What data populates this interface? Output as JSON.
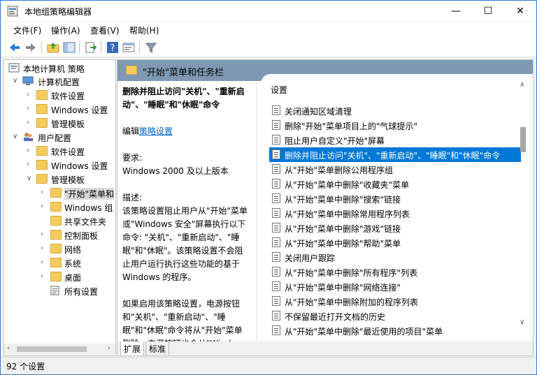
{
  "window": {
    "title": "本地组策略编辑器",
    "minimize": "—",
    "maximize": "☐",
    "close": "✕"
  },
  "menu": {
    "items": [
      "文件(F)",
      "操作(A)",
      "查看(V)",
      "帮助(H)"
    ]
  },
  "toolbar": {
    "icons": [
      "back-arrow-icon",
      "forward-arrow-icon",
      "up-folder-icon",
      "show-hide-tree-icon",
      "export-list-icon",
      "help-icon",
      "properties-icon",
      "filter-icon"
    ]
  },
  "tree": {
    "root": "本地计算机 策略",
    "computer_config": "计算机配置",
    "cc_software": "软件设置",
    "cc_windows": "Windows 设置",
    "cc_admin": "管理模板",
    "user_config": "用户配置",
    "uc_software": "软件设置",
    "uc_windows": "Windows 设置",
    "uc_admin": "管理模板",
    "start_menu": "\"开始\"菜单和",
    "windows_comp": "Windows 组",
    "shared_folders": "共享文件夹",
    "control_panel": "控制面板",
    "network": "网络",
    "system": "系统",
    "desktop": "桌面",
    "all_settings": "所有设置"
  },
  "header": {
    "title": "\"开始\"菜单和任务栏"
  },
  "description": {
    "policy_title": "删除并阻止访问\"关机\"、\"重新启动\"、\"睡眠\"和\"休眠\"命令",
    "edit_prefix": "编辑",
    "edit_link": "策略设置",
    "requirements_label": "要求:",
    "requirements_value": "Windows 2000 及以上版本",
    "description_label": "描述:",
    "description_body": "该策略设置阻止用户从\"开始\"菜单或\"Windows 安全\"屏幕执行以下命令: \"关机\"、\"重新启动\"、\"睡眠\"和\"休眠\"。该策略设置不会阻止用户运行执行这些功能的基于 Windows 的程序。",
    "enable_body": "如果启用该策略设置，电源按钮和\"关机\"、\"重新启动\"、\"睡眠\"和\"休眠\"命令将从\"开始\"菜单删除。电源按钮也会从\"Windows 安全\"屏幕删除，该屏幕在按 CTRL+ALT+DELETE 时出现。"
  },
  "list": {
    "header": "设置",
    "items": [
      "关闭通知区域清理",
      "删除\"开始\"菜单项目上的\"气球提示\"",
      "阻止用户自定义\"开始\"屏幕",
      "删除并阻止访问\"关机\"、\"重新启动\"、\"睡眠\"和\"休眠\"命令",
      "从\"开始\"菜单删除公用程序组",
      "从\"开始\"菜单中删除\"收藏夹\"菜单",
      "从\"开始\"菜单中删除\"搜索\"链接",
      "从\"开始\"菜单中删除常用程序列表",
      "从\"开始\"菜单中删除\"游戏\"链接",
      "从\"开始\"菜单中删除\"帮助\"菜单",
      "关闭用户跟踪",
      "从\"开始\"菜单中删除\"所有程序\"列表",
      "从\"开始\"菜单中删除\"网络连接\"",
      "从\"开始\"菜单中删除附加的程序列表",
      "不保留最近打开文档的历史",
      "从\"开始\"菜单中删除\"最近使用的项目\"菜单"
    ],
    "selected_index": 3
  },
  "tabs": {
    "extended": "扩展",
    "standard": "标准"
  },
  "status": {
    "text": "92 个设置"
  },
  "colors": {
    "selection": "#0078d7",
    "header_band": "#7f99b4",
    "link": "#0066cc",
    "folder": "#f5cb5c"
  }
}
